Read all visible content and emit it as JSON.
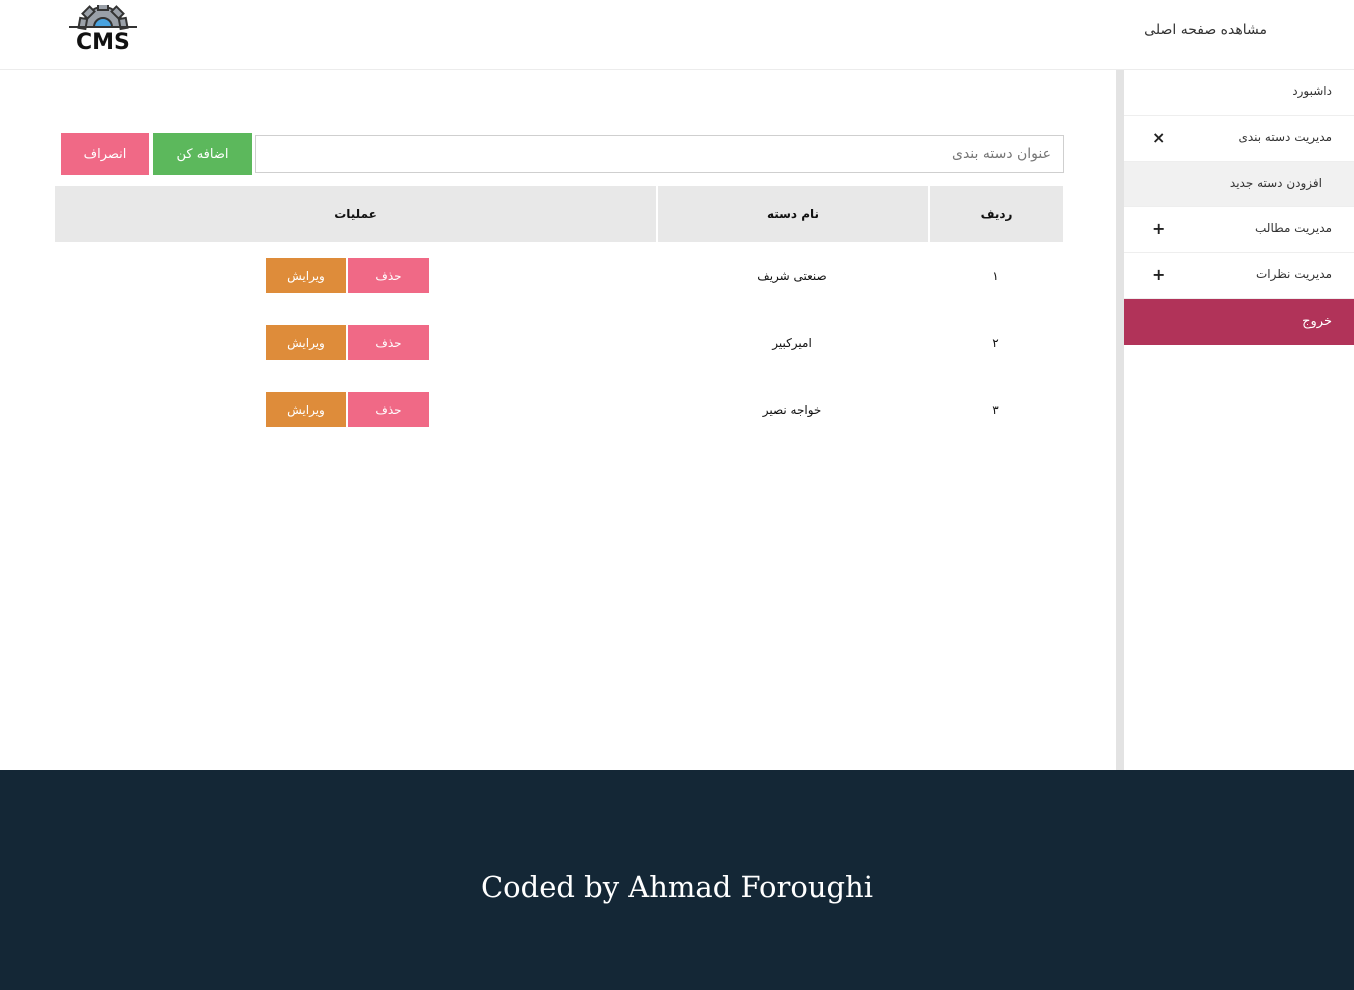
{
  "header": {
    "home_link": "مشاهده صفحه اصلی",
    "logo_text": "CMS"
  },
  "sidebar": {
    "items": [
      {
        "label": "داشبورد",
        "toggle": ""
      },
      {
        "label": "مدیریت دسته بندی",
        "toggle": "×"
      },
      {
        "label": "افزودن دسته جدید",
        "toggle": ""
      },
      {
        "label": "مدیریت مطالب",
        "toggle": "+"
      },
      {
        "label": "مدیریت نظرات",
        "toggle": "+"
      },
      {
        "label": "خروج",
        "toggle": ""
      }
    ]
  },
  "form": {
    "placeholder": "عنوان دسته بندی",
    "value": "",
    "add_label": "اضافه کن",
    "cancel_label": "انصراف"
  },
  "table": {
    "headers": [
      "ردیف",
      "نام دسته",
      "عملیات"
    ],
    "delete_label": "حذف",
    "edit_label": "ویرایش",
    "rows": [
      {
        "index": "۱",
        "name": "صنعتی شریف"
      },
      {
        "index": "۲",
        "name": "امیرکبیر"
      },
      {
        "index": "۳",
        "name": "خواجه نصیر"
      }
    ]
  },
  "footer": {
    "text": "Coded by Ahmad Foroughi"
  },
  "colors": {
    "add": "#5cb85c",
    "cancel": "#f06986",
    "delete": "#f06986",
    "edit": "#de8c3a",
    "exit": "#b13359",
    "footer": "#142736"
  }
}
